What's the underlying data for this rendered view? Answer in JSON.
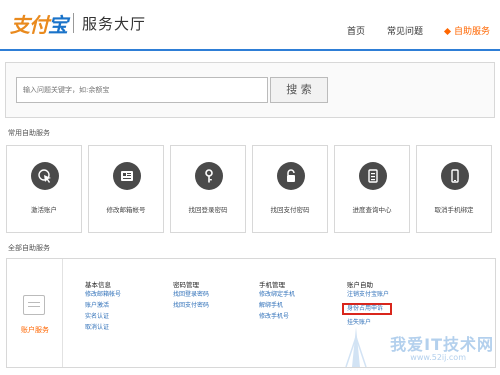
{
  "header": {
    "logo_mark_a": "支付",
    "logo_mark_b": "宝",
    "logo_text": "服务大厅",
    "nav": [
      "首页",
      "常见问题",
      "自助服务"
    ],
    "active_nav": 2
  },
  "search": {
    "placeholder": "输入问题关键字，如:余额宝",
    "button": "搜 索"
  },
  "common": {
    "title": "常用自助服务",
    "tiles": [
      {
        "label": "激活账户",
        "icon": "cursor-click-icon"
      },
      {
        "label": "修改邮箱帐号",
        "icon": "id-card-icon"
      },
      {
        "label": "找回登录密码",
        "icon": "key-icon"
      },
      {
        "label": "找回支付密码",
        "icon": "lock-icon"
      },
      {
        "label": "进度查询中心",
        "icon": "document-list-icon"
      },
      {
        "label": "取消手机绑定",
        "icon": "mobile-phone-icon"
      }
    ]
  },
  "all": {
    "title": "全部自助服务",
    "account_label": "账户服务",
    "columns": [
      {
        "head": "基本信息",
        "links": [
          "修改邮箱帐号",
          "账户激活",
          "实名认证",
          "取消认证"
        ]
      },
      {
        "head": "密码管理",
        "links": [
          "找回登录密码",
          "找回支付密码"
        ]
      },
      {
        "head": "手机管理",
        "links": [
          "修改绑定手机",
          "解绑手机",
          "修改手机号"
        ]
      },
      {
        "head": "账户自助",
        "links": [
          "注销支付宝账户",
          "身份占用申诉",
          "挂失账户"
        ]
      }
    ],
    "highlighted": "身份占用申诉"
  },
  "watermark": {
    "text": "我爱IT技术网",
    "url": "www.52ij.com"
  },
  "colors": {
    "accent_orange": "#ff6600",
    "brand_blue": "#2e7ed6",
    "link_blue": "#2e6fb8",
    "highlight_red": "#d9261c"
  }
}
